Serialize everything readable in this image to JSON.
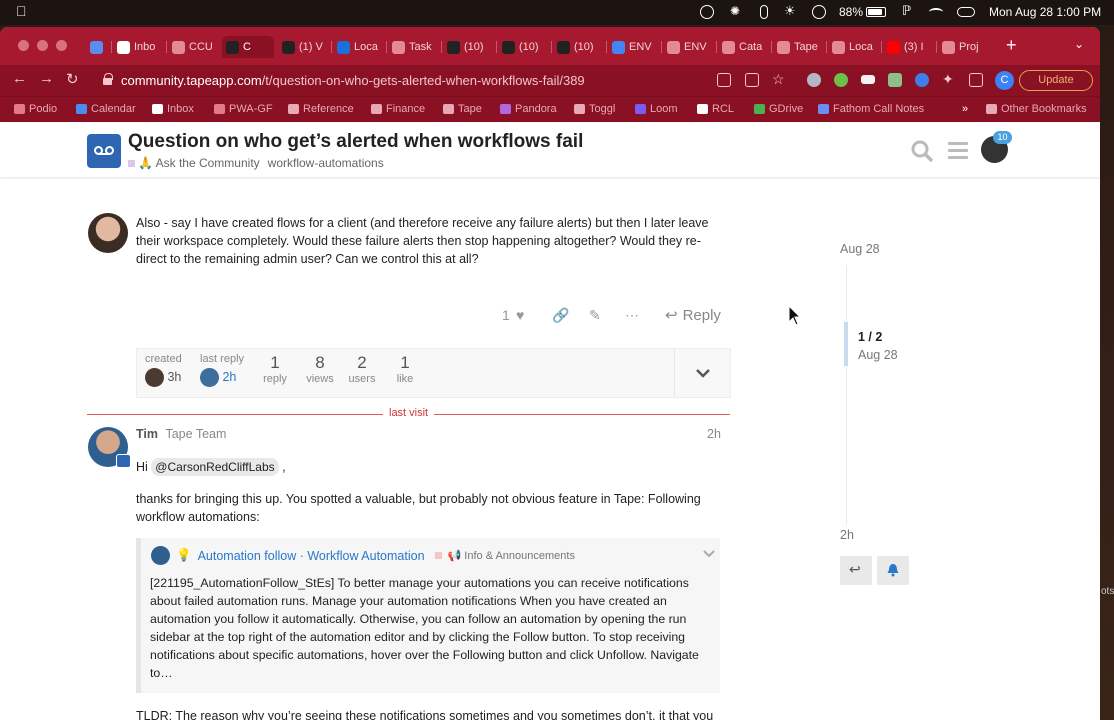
{
  "menubar": {
    "battery_pct": "88%",
    "battery_level": 0.88,
    "clock": "Mon Aug 28  1:00 PM"
  },
  "browser": {
    "tabs": [
      {
        "label": "",
        "color": "#5b8def"
      },
      {
        "label": "Inbo",
        "color": "#ffffff"
      },
      {
        "label": "CCU",
        "color": "#e48a97"
      },
      {
        "label": "C",
        "color": "#222222"
      },
      {
        "label": "(1) V",
        "color": "#222222"
      },
      {
        "label": "Loca",
        "color": "#1e6fd9"
      },
      {
        "label": "Task",
        "color": "#e48a97"
      },
      {
        "label": "(10)",
        "color": "#222222"
      },
      {
        "label": "(10)",
        "color": "#222222"
      },
      {
        "label": "(10)",
        "color": "#222222"
      },
      {
        "label": "ENV",
        "color": "#4285f4"
      },
      {
        "label": "ENV",
        "color": "#e48a97"
      },
      {
        "label": "Cata",
        "color": "#e48a97"
      },
      {
        "label": "Tape",
        "color": "#e48a97"
      },
      {
        "label": "Loca",
        "color": "#e48a97"
      },
      {
        "label": "(3) I",
        "color": "#ff0000"
      },
      {
        "label": "Proj",
        "color": "#e48a97"
      }
    ],
    "new_tab": "+",
    "url_domain": "community.tapeapp.com",
    "url_path": "/t/question-on-who-gets-alerted-when-workflows-fail/389",
    "profile_initial": "C",
    "update_label": "Update",
    "bookmarks": [
      {
        "label": "Podio",
        "color": "#e07b8a"
      },
      {
        "label": "Calendar",
        "color": "#4a8cf0"
      },
      {
        "label": "Inbox",
        "color": "#ffffff"
      },
      {
        "label": "PWA-GF",
        "color": "#e07b8a"
      },
      {
        "label": "Reference",
        "color": "#e7a9b3"
      },
      {
        "label": "Finance",
        "color": "#e7a9b3"
      },
      {
        "label": "Tape",
        "color": "#e7a9b3"
      },
      {
        "label": "Pandora",
        "color": "#b368e0"
      },
      {
        "label": "Toggl",
        "color": "#e7a9b3"
      },
      {
        "label": "Loom",
        "color": "#7c5cf0"
      },
      {
        "label": "RCL",
        "color": "#ffffff"
      },
      {
        "label": "GDrive",
        "color": "#4caf50"
      },
      {
        "label": "Fathom Call Notes",
        "color": "#6c8cf0"
      }
    ],
    "bookmarks_more": "»",
    "other_bookmarks": "Other Bookmarks"
  },
  "header": {
    "title": "Question on who get’s alerted when workflows fail",
    "category": "🙏 Ask the Community",
    "tag": "workflow-automations",
    "notifications": "10"
  },
  "post1": {
    "text": "Also - say I have created flows for a client (and therefore receive any failure alerts) but then I later leave their workspace completely. Would these failure alerts then stop happening altogether? Would they re-direct to the remaining admin user? Can we control this at all?",
    "like_count": "1",
    "reply_label": "Reply"
  },
  "topic_map": {
    "created_label": "created",
    "created_value": "3h",
    "last_reply_label": "last reply",
    "last_reply_value": "2h",
    "stats": [
      {
        "value": "1",
        "label": "reply"
      },
      {
        "value": "8",
        "label": "views"
      },
      {
        "value": "2",
        "label": "users"
      },
      {
        "value": "1",
        "label": "like"
      }
    ]
  },
  "last_visit": "last visit",
  "post2": {
    "author": "Tim",
    "author_title": "Tape Team",
    "age": "2h",
    "greeting": "Hi",
    "mention": "@CarsonRedCliffLabs",
    "greeting_end": ",",
    "para1": "thanks for bringing this up. You spotted a valuable, but probably not obvious feature in Tape: Following workflow automations:",
    "quote": {
      "emoji": "💡",
      "title": "Automation follow · Workflow Automation",
      "category": "📢 Info & Announcements",
      "body": "[221195_AutomationFollow_StEs] To better manage your automations you can receive notifications about failed automation runs. Manage your automation notifications When you have created an automation you follow it automatically. Otherwise, you can follow an automation by opening the run sidebar at the top right of the automation editor and by clicking the Follow button. To stop receiving notifications about specific automations, hover over the Following button and click Unfollow. Navigate to…"
    },
    "tldr": "TLDR: The reason why you’re seeing these notifications sometimes and you sometimes don’t, it that you follow some of the automations. How to follow/unfollow can be seen in above linked post."
  },
  "timeline": {
    "top_date": "Aug 28",
    "position": "1 / 2",
    "position_date": "Aug 28",
    "bottom_date": "2h"
  },
  "colors": {
    "tabstrip": "#a6192e",
    "toolbar": "#8a1024",
    "link": "#2a78c8",
    "logo": "#2f66b4"
  }
}
